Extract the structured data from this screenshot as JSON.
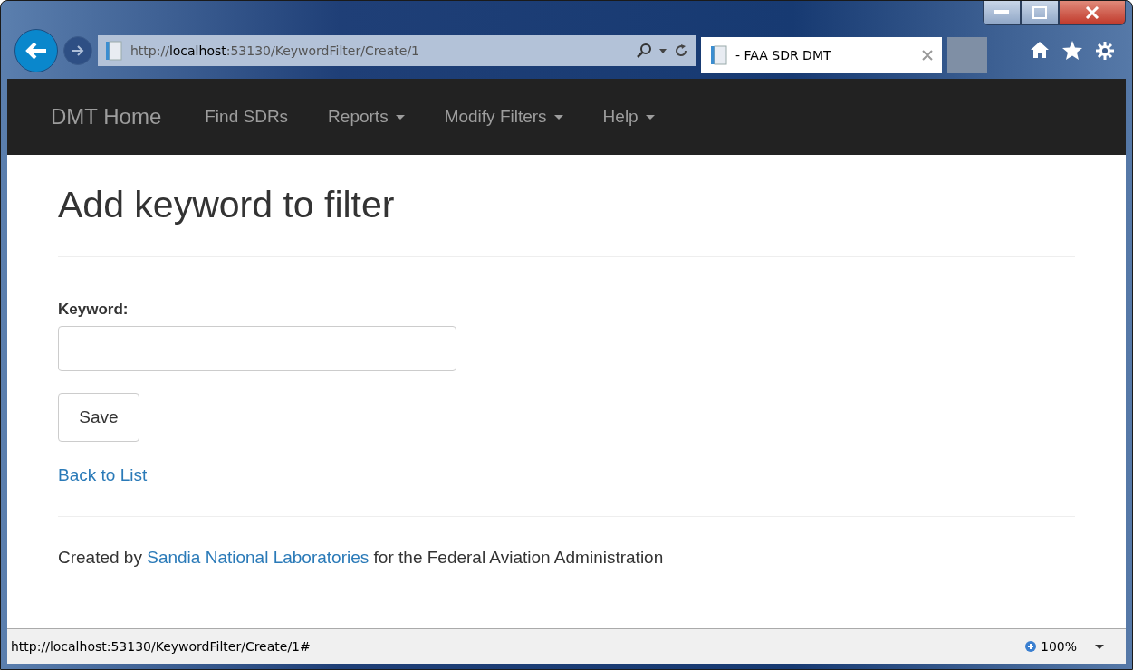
{
  "browser": {
    "address": "http://**localhost**:53130/KeywordFilter/Create/1",
    "tab_title": "- FAA SDR DMT"
  },
  "navbar": {
    "brand": "DMT Home",
    "items": [
      {
        "label": "Find SDRs",
        "dropdown": false
      },
      {
        "label": "Reports",
        "dropdown": true
      },
      {
        "label": "Modify Filters",
        "dropdown": true
      },
      {
        "label": "Help",
        "dropdown": true
      }
    ]
  },
  "page": {
    "heading": "Add keyword to filter",
    "field_label": "Keyword:",
    "save_button": "Save",
    "back_link": "Back to List"
  },
  "footer": {
    "prefix": "Created by",
    "link": "Sandia National Laboratories",
    "suffix": "for the Federal Aviation Administration"
  },
  "status_bar": {
    "url": "http://localhost:53130/KeywordFilter/Create/1#",
    "zoom": "100%"
  }
}
